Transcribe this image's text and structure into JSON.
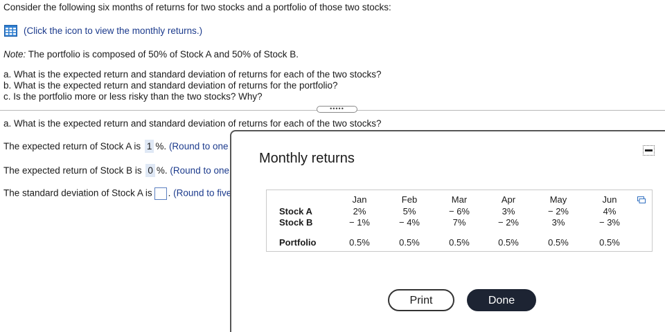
{
  "question": {
    "intro": "Consider the following six months of returns for two stocks and a portfolio of those two stocks:",
    "icon_link": "(Click the icon to view the monthly returns.)",
    "note_label": "Note:",
    "note_text": " The portfolio is composed of 50% of Stock A and 50% of Stock B.",
    "parts": [
      "a. What is the expected return and standard deviation of returns for each of the two stocks?",
      "b. What is the expected return and standard deviation of returns for the portfolio?",
      "c. Is the portfolio more or less risky than the two stocks? Why?"
    ],
    "divider_dots": "•••••"
  },
  "answer": {
    "part_a_heading": "a. What is the expected return and standard deviation of returns for each of the two stocks?",
    "line1_prefix": "The expected return of Stock A is",
    "line1_value": "1",
    "line1_suffix": "%.",
    "line1_hint": "(Round to one de",
    "line2_prefix": "The expected return of Stock B is",
    "line2_value": "0",
    "line2_suffix": "%.",
    "line2_hint": "(Round to one de",
    "line3_prefix": "The standard deviation of Stock A is",
    "line3_suffix": ".",
    "line3_hint": "(Round to five d"
  },
  "dialog": {
    "title": "Monthly returns",
    "months": [
      "Jan",
      "Feb",
      "Mar",
      "Apr",
      "May",
      "Jun"
    ],
    "rows": [
      {
        "label": "Stock A",
        "values": [
          "2%",
          "5%",
          "− 6%",
          "3%",
          "− 2%",
          "4%"
        ]
      },
      {
        "label": "Stock B",
        "values": [
          "− 1%",
          "− 4%",
          "7%",
          "− 2%",
          "3%",
          "− 3%"
        ]
      },
      {
        "label": "Portfolio",
        "values": [
          "0.5%",
          "0.5%",
          "0.5%",
          "0.5%",
          "0.5%",
          "0.5%"
        ]
      }
    ],
    "print_label": "Print",
    "done_label": "Done"
  }
}
